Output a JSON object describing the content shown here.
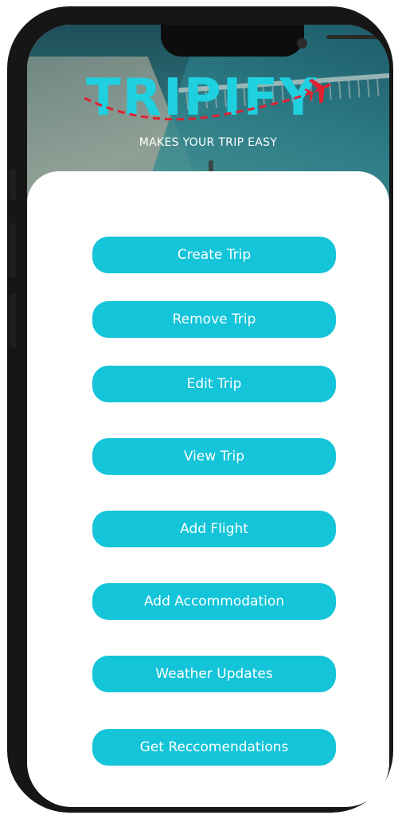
{
  "app": {
    "logo_text": "TRIPIFY",
    "tagline": "MAKES YOUR TRIP EASY"
  },
  "theme": {
    "accent": "#14c4d9",
    "logo_color": "#1fd0e0",
    "plane_color": "#e02030",
    "phone_frame": "#161616"
  },
  "menu": {
    "items": [
      {
        "label": "Create Trip"
      },
      {
        "label": "Remove Trip"
      },
      {
        "label": "Edit Trip"
      },
      {
        "label": "View Trip"
      },
      {
        "label": "Add Flight"
      },
      {
        "label": "Add Accommodation"
      },
      {
        "label": "Weather Updates"
      },
      {
        "label": "Get Reccomendations"
      }
    ]
  },
  "icons": {
    "logo_plane": "airplane-icon"
  }
}
